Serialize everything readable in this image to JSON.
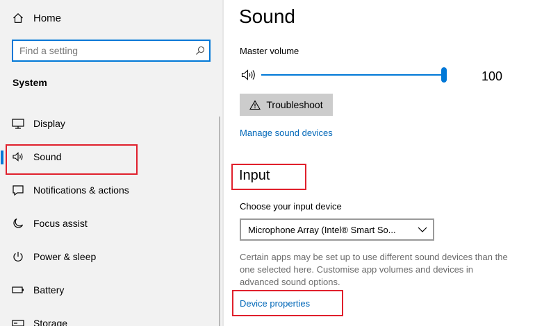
{
  "sidebar": {
    "home_label": "Home",
    "search_placeholder": "Find a setting",
    "section_title": "System",
    "items": [
      {
        "label": "Display",
        "icon": "monitor-icon"
      },
      {
        "label": "Sound",
        "icon": "speaker-icon",
        "active": true
      },
      {
        "label": "Notifications & actions",
        "icon": "notification-icon"
      },
      {
        "label": "Focus assist",
        "icon": "moon-icon"
      },
      {
        "label": "Power & sleep",
        "icon": "power-icon"
      },
      {
        "label": "Battery",
        "icon": "battery-icon"
      },
      {
        "label": "Storage",
        "icon": "storage-icon"
      }
    ]
  },
  "main": {
    "title": "Sound",
    "master_volume_label": "Master volume",
    "volume_value": "100",
    "troubleshoot_label": "Troubleshoot",
    "manage_link": "Manage sound devices",
    "input_heading": "Input",
    "choose_input_label": "Choose your input device",
    "input_device": "Microphone Array (Intel® Smart So...",
    "info_text": "Certain apps may be set up to use different sound devices than the one selected here. Customise app volumes and devices in advanced sound options.",
    "device_properties_link": "Device properties"
  },
  "colors": {
    "accent": "#0078d7",
    "link": "#0067b8",
    "highlight_box": "#e0202c",
    "sidebar_bg": "#f2f2f2"
  }
}
